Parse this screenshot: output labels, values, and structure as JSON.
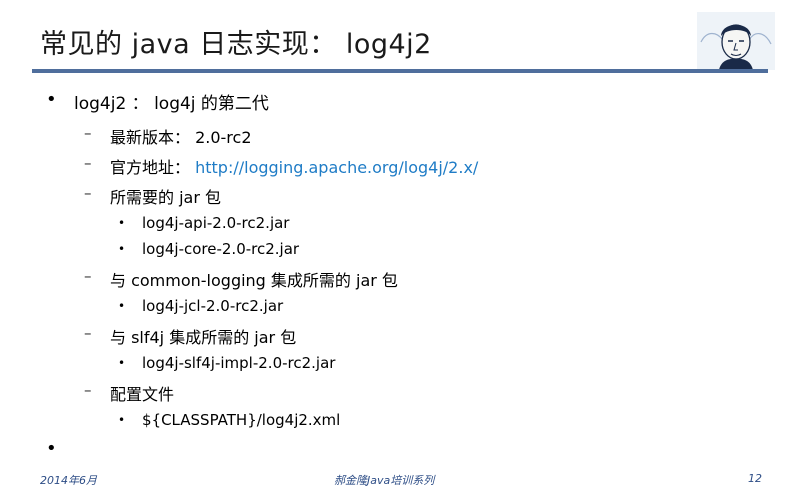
{
  "slide": {
    "title": "常见的 java 日志实现： log4j2",
    "items": [
      {
        "text": "log4j2 ： log4j 的第二代"
      },
      {
        "text": "最新版本： 2.0-rc2"
      },
      {
        "label": "官方地址：",
        "link": "http://logging.apache.org/log4j/2.x/"
      },
      {
        "text": "所需要的 jar 包"
      },
      {
        "text": "log4j-api-2.0-rc2.jar"
      },
      {
        "text": "log4j-core-2.0-rc2.jar"
      },
      {
        "text": "与 common-logging 集成所需的 jar 包"
      },
      {
        "text": "log4j-jcl-2.0-rc2.jar"
      },
      {
        "text": "与 slf4j 集成所需的 jar 包"
      },
      {
        "text": "log4j-slf4j-impl-2.0-rc2.jar"
      },
      {
        "text": "配置文件"
      },
      {
        "text": "${CLASSPATH}/log4j2.xml"
      }
    ],
    "bullets": {
      "level1": "•",
      "level2": "–",
      "level3": "•"
    }
  },
  "footer": {
    "date": "2014年6月",
    "center": "郝金隆Java培训系列",
    "page": "12"
  },
  "colors": {
    "title_rule": "#4f6e9c",
    "link": "#1f7cc6",
    "footer_text": "#2d4d86"
  },
  "icons": {
    "avatar": "portrait-sketch"
  }
}
